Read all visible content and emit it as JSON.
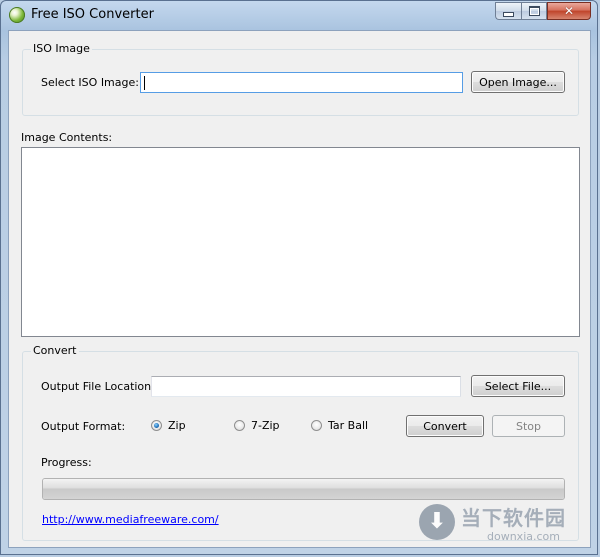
{
  "window": {
    "title": "Free ISO Converter"
  },
  "iso_group": {
    "title": "ISO Image",
    "select_label": "Select ISO Image:",
    "iso_path_value": "",
    "open_button": "Open Image..."
  },
  "contents": {
    "label": "Image Contents:"
  },
  "convert_group": {
    "title": "Convert",
    "output_location_label": "Output File Location:",
    "output_location_value": "",
    "select_file_button": "Select File...",
    "output_format_label": "Output Format:",
    "formats": [
      {
        "label": "Zip",
        "selected": true
      },
      {
        "label": "7-Zip",
        "selected": false
      },
      {
        "label": "Tar Ball",
        "selected": false
      }
    ],
    "convert_button": "Convert",
    "stop_button": "Stop",
    "progress_label": "Progress:",
    "progress_value": 1.0
  },
  "link": {
    "text": "http://www.mediafreeware.com/"
  },
  "watermark": {
    "brand": "当下软件园",
    "url": "downxia.com"
  },
  "colors": {
    "accent": "#569de5",
    "progress": "#39b21e",
    "link": "#0000ff"
  },
  "icons": {
    "app": "app-disc-icon",
    "minimize": "minimize-icon",
    "maximize": "maximize-icon",
    "close": "close-icon"
  }
}
